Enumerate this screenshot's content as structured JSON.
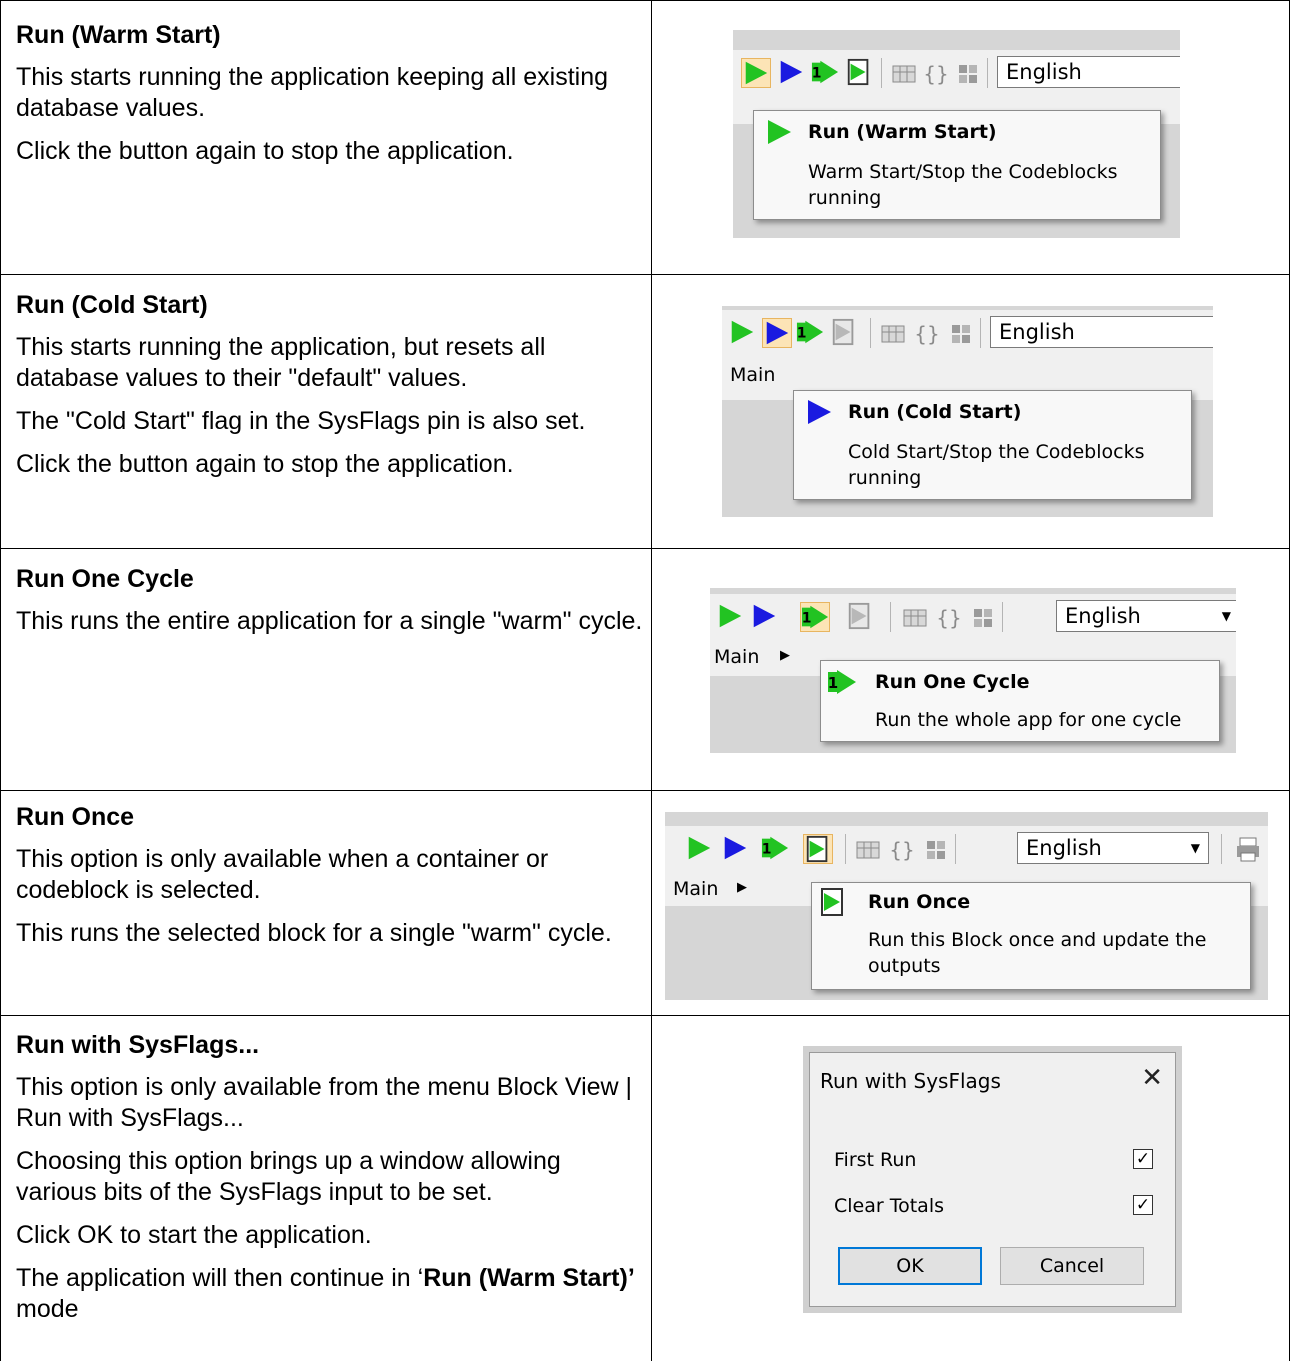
{
  "rows": [
    {
      "title": "Run (Warm Start)",
      "paragraphs": [
        "This starts running the application keeping all existing database values.",
        "Click the button again to stop the application."
      ],
      "tooltip_title": "Run (Warm Start)",
      "tooltip_desc": "Warm Start/Stop the Codeblocks running",
      "main_label": "",
      "language": "English"
    },
    {
      "title": "Run (Cold Start)",
      "paragraphs": [
        "This starts running the application, but resets all database values to their \"default\" values.",
        "The \"Cold Start\" flag in the SysFlags pin is also set.",
        "Click the button again to stop the application."
      ],
      "tooltip_title": "Run (Cold Start)",
      "tooltip_desc": "Cold Start/Stop the Codeblocks running",
      "main_label": "Main",
      "language": "English"
    },
    {
      "title": "Run One Cycle",
      "paragraphs": [
        "This runs the entire application for a single \"warm\" cycle."
      ],
      "tooltip_title": "Run One Cycle",
      "tooltip_desc": "Run the whole app for one cycle",
      "main_label": "Main",
      "language": "English"
    },
    {
      "title": "Run Once",
      "paragraphs": [
        "This option is only available when a container or codeblock is selected.",
        "This runs the selected block for a single \"warm\" cycle."
      ],
      "tooltip_title": "Run Once",
      "tooltip_desc": "Run this Block once and update the outputs",
      "main_label": "Main",
      "language": "English"
    },
    {
      "title": "Run with SysFlags...",
      "paragraphs": [
        "This option is only available from the menu Block View | Run with SysFlags...",
        "Choosing this option brings up a window allowing various bits of the SysFlags input to be set.",
        "Click OK to start the application."
      ],
      "last_para_pre": "The application will then continue in ‘",
      "last_para_bold": "Run (Warm Start)’",
      "last_para_post": " mode"
    }
  ],
  "dialog": {
    "title": "Run with SysFlags",
    "close": "✕",
    "first_run": "First Run",
    "first_run_checked": true,
    "clear_totals": "Clear Totals",
    "clear_totals_checked": true,
    "check_mark": "✓",
    "ok": "OK",
    "cancel": "Cancel"
  },
  "colors": {
    "green": "#22c322",
    "blue": "#1a1ae0",
    "toolbar": "#f0f0f0",
    "highlight": "#fce4b6"
  },
  "icons": [
    "run-warm-icon",
    "run-cold-icon",
    "run-one-cycle-icon",
    "run-once-icon",
    "grid-icon",
    "braces-icon",
    "block-icon",
    "dropdown-caret-icon",
    "close-icon",
    "check-icon"
  ]
}
